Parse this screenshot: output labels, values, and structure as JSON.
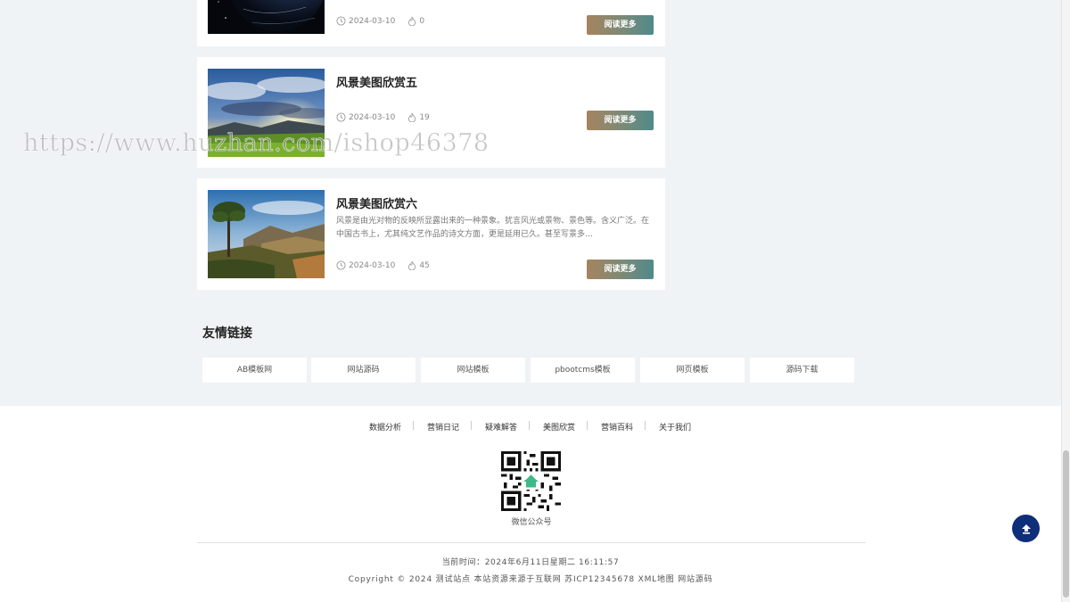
{
  "articles": [
    {
      "title": "",
      "description": "",
      "date": "2024-03-10",
      "likes": "0",
      "read_more": "阅读更多",
      "thumb": "earth-night-image"
    },
    {
      "title": "风景美图欣赏五",
      "description": "",
      "date": "2024-03-10",
      "likes": "19",
      "read_more": "阅读更多",
      "thumb": "sunrise-sky-landscape-image"
    },
    {
      "title": "风景美图欣赏六",
      "description": "风景是由光对物的反映所显露出来的一种景象。犹言风光或景物、景色等。含义广泛。在中国古书上，尤其纯文艺作品的诗文方面，更是延用已久。甚至写景多…",
      "date": "2024-03-10",
      "likes": "45",
      "read_more": "阅读更多",
      "thumb": "tree-cliff-landscape-image"
    }
  ],
  "friend_links": {
    "title": "友情链接",
    "items": [
      "AB模板网",
      "网站源码",
      "网站模板",
      "pbootcms模板",
      "网页模板",
      "源码下载"
    ]
  },
  "footer": {
    "nav": [
      "数据分析",
      "营销日记",
      "疑难解答",
      "美图欣赏",
      "营销百科",
      "关于我们"
    ],
    "qr_label": "微信公众号",
    "time_text": "当前时间：2024年6月11日星期二 16:11:57",
    "copyright": "Copyright © 2024 测试站点 本站资源来源于互联网 苏ICP12345678 XML地图 网站源码"
  },
  "watermark": "https://www.huzhan.com/ishop46378",
  "colors": {
    "page_bg": "#f0f3f5",
    "button_gradient_start": "#a6845e",
    "button_gradient_end": "#4f8a8b",
    "back_to_top": "#0f2e7a"
  },
  "icons": {
    "date": "clock-icon",
    "likes": "flame-icon",
    "back_to_top": "arrow-up-icon",
    "qr": "qr-code-icon"
  }
}
